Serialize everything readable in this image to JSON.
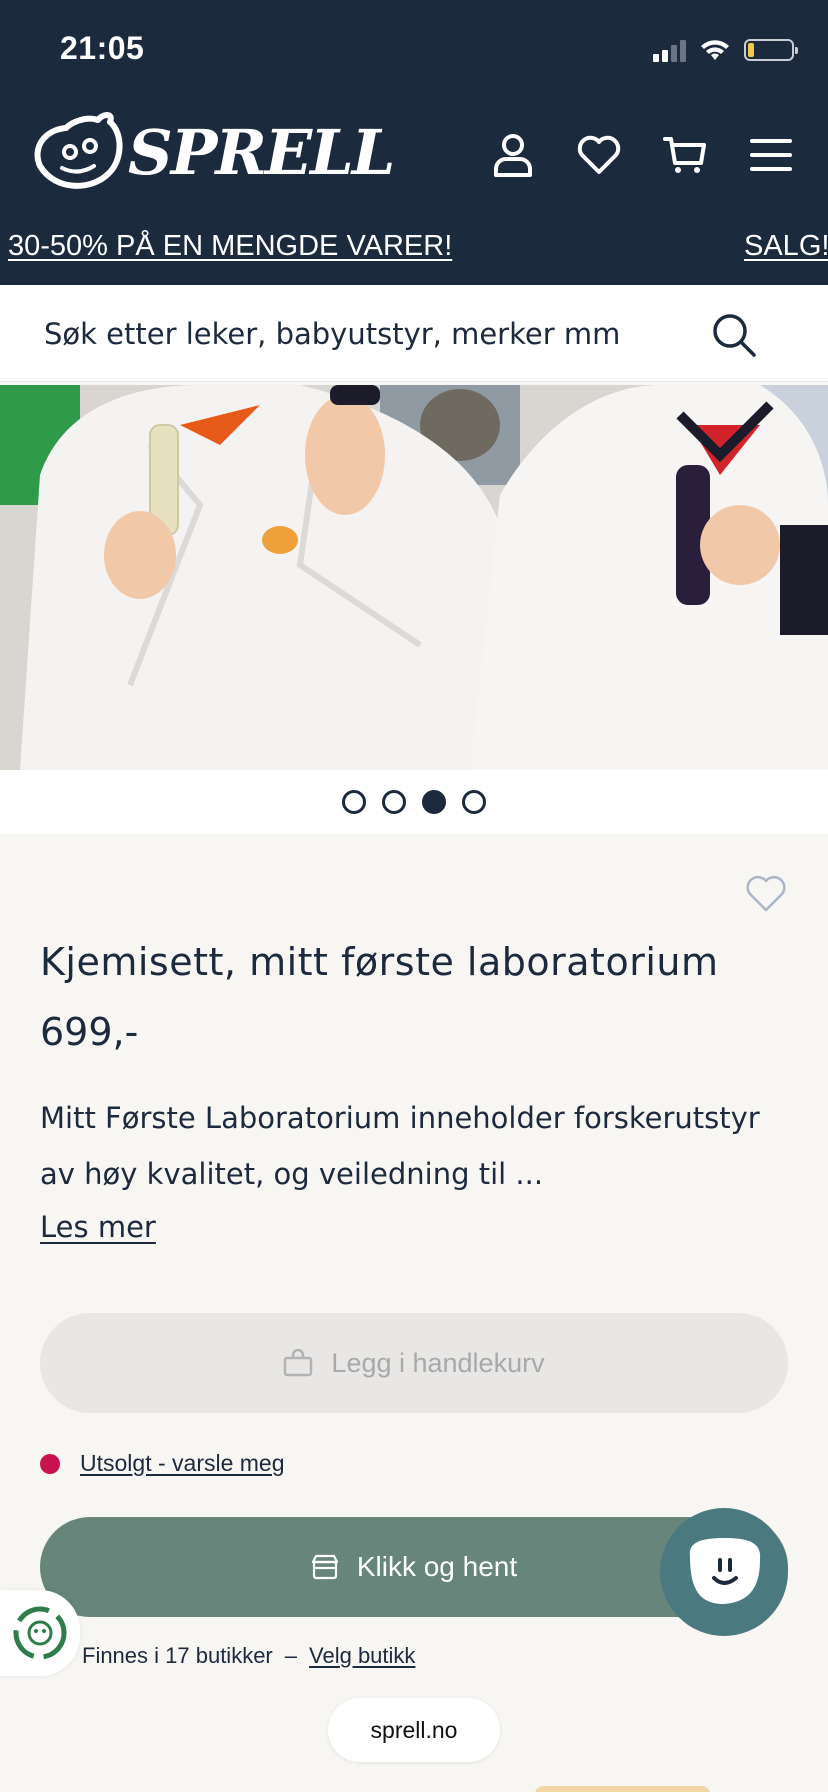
{
  "status_bar": {
    "time": "21:05"
  },
  "header": {
    "brand": "SPRELL",
    "nav_icons": [
      "user-icon",
      "heart-icon",
      "cart-icon",
      "menu-icon"
    ],
    "promo_left": "30-50% PÅ EN MENGDE VARER!",
    "promo_right": "SALG!"
  },
  "search": {
    "placeholder": "Søk etter leker, babyutstyr, merker mm"
  },
  "carousel": {
    "total": 4,
    "active_index": 2
  },
  "product": {
    "title": "Kjemisett, mitt første laboratorium",
    "price": "699,-",
    "description": "Mitt Første Laboratorium inneholder forskerutstyr av høy kvalitet, og veiledning til ...",
    "read_more": "Les mer",
    "add_to_cart": "Legg i handlekurv",
    "stock_status": "Utsolgt - varsle meg",
    "click_collect": "Klikk og hent",
    "stores_text": "Finnes i 17 butikker",
    "stores_sep": "–",
    "choose_store": "Velg butikk"
  },
  "browser": {
    "url": "sprell.no"
  },
  "colors": {
    "header_bg": "#1c2a3e",
    "pickup_button": "#67857a",
    "chat_button": "#4a7a80",
    "stock_bullet": "#c7134f"
  }
}
